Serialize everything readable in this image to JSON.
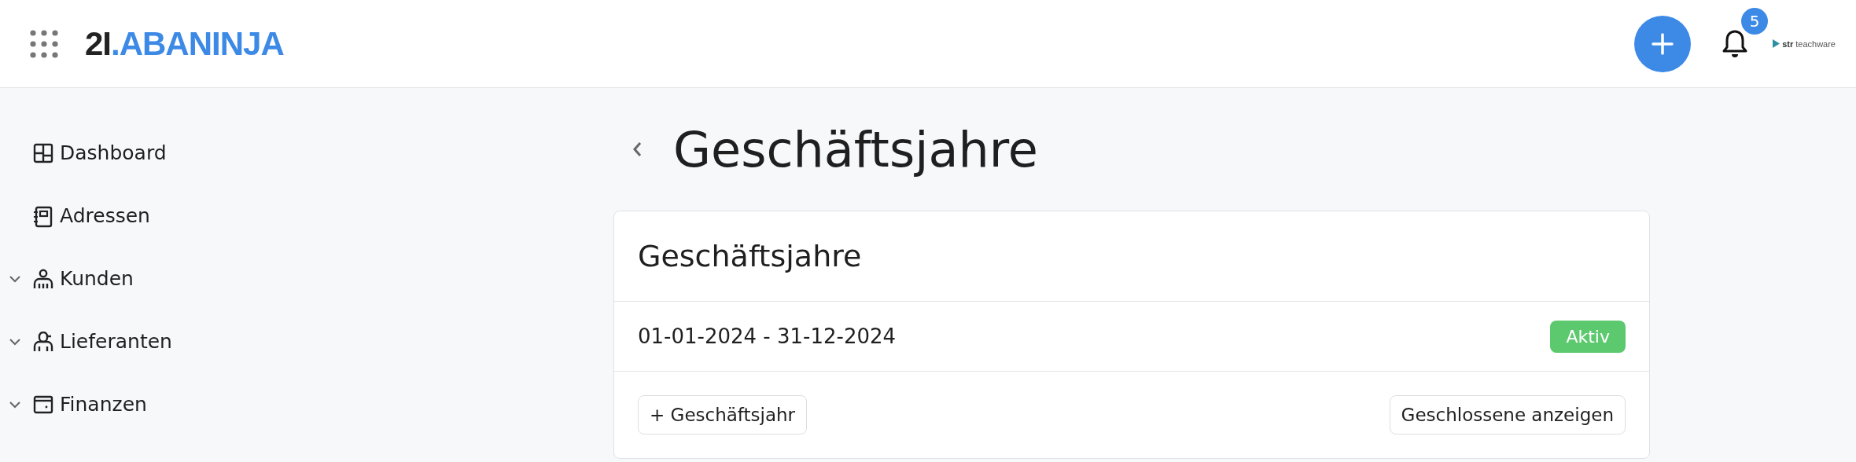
{
  "header": {
    "logo": {
      "number": "2I",
      "dot": ".",
      "name": "ABANINJA"
    },
    "notifications": {
      "count": "5"
    },
    "partner_logo": {
      "name": "str",
      "suffix": "teachware"
    }
  },
  "sidebar": {
    "items": [
      {
        "label": "Dashboard",
        "expandable": false
      },
      {
        "label": "Adressen",
        "expandable": false
      },
      {
        "label": "Kunden",
        "expandable": true
      },
      {
        "label": "Lieferanten",
        "expandable": true
      },
      {
        "label": "Finanzen",
        "expandable": true
      }
    ]
  },
  "page": {
    "title": "Geschäftsjahre"
  },
  "card": {
    "title": "Geschäftsjahre",
    "rows": [
      {
        "period": "01-01-2024 - 31-12-2024",
        "status": "Aktiv"
      }
    ],
    "buttons": [
      {
        "label": "+ Geschäftsjahr"
      },
      {
        "label": "Geschlossene anzeigen"
      }
    ]
  }
}
